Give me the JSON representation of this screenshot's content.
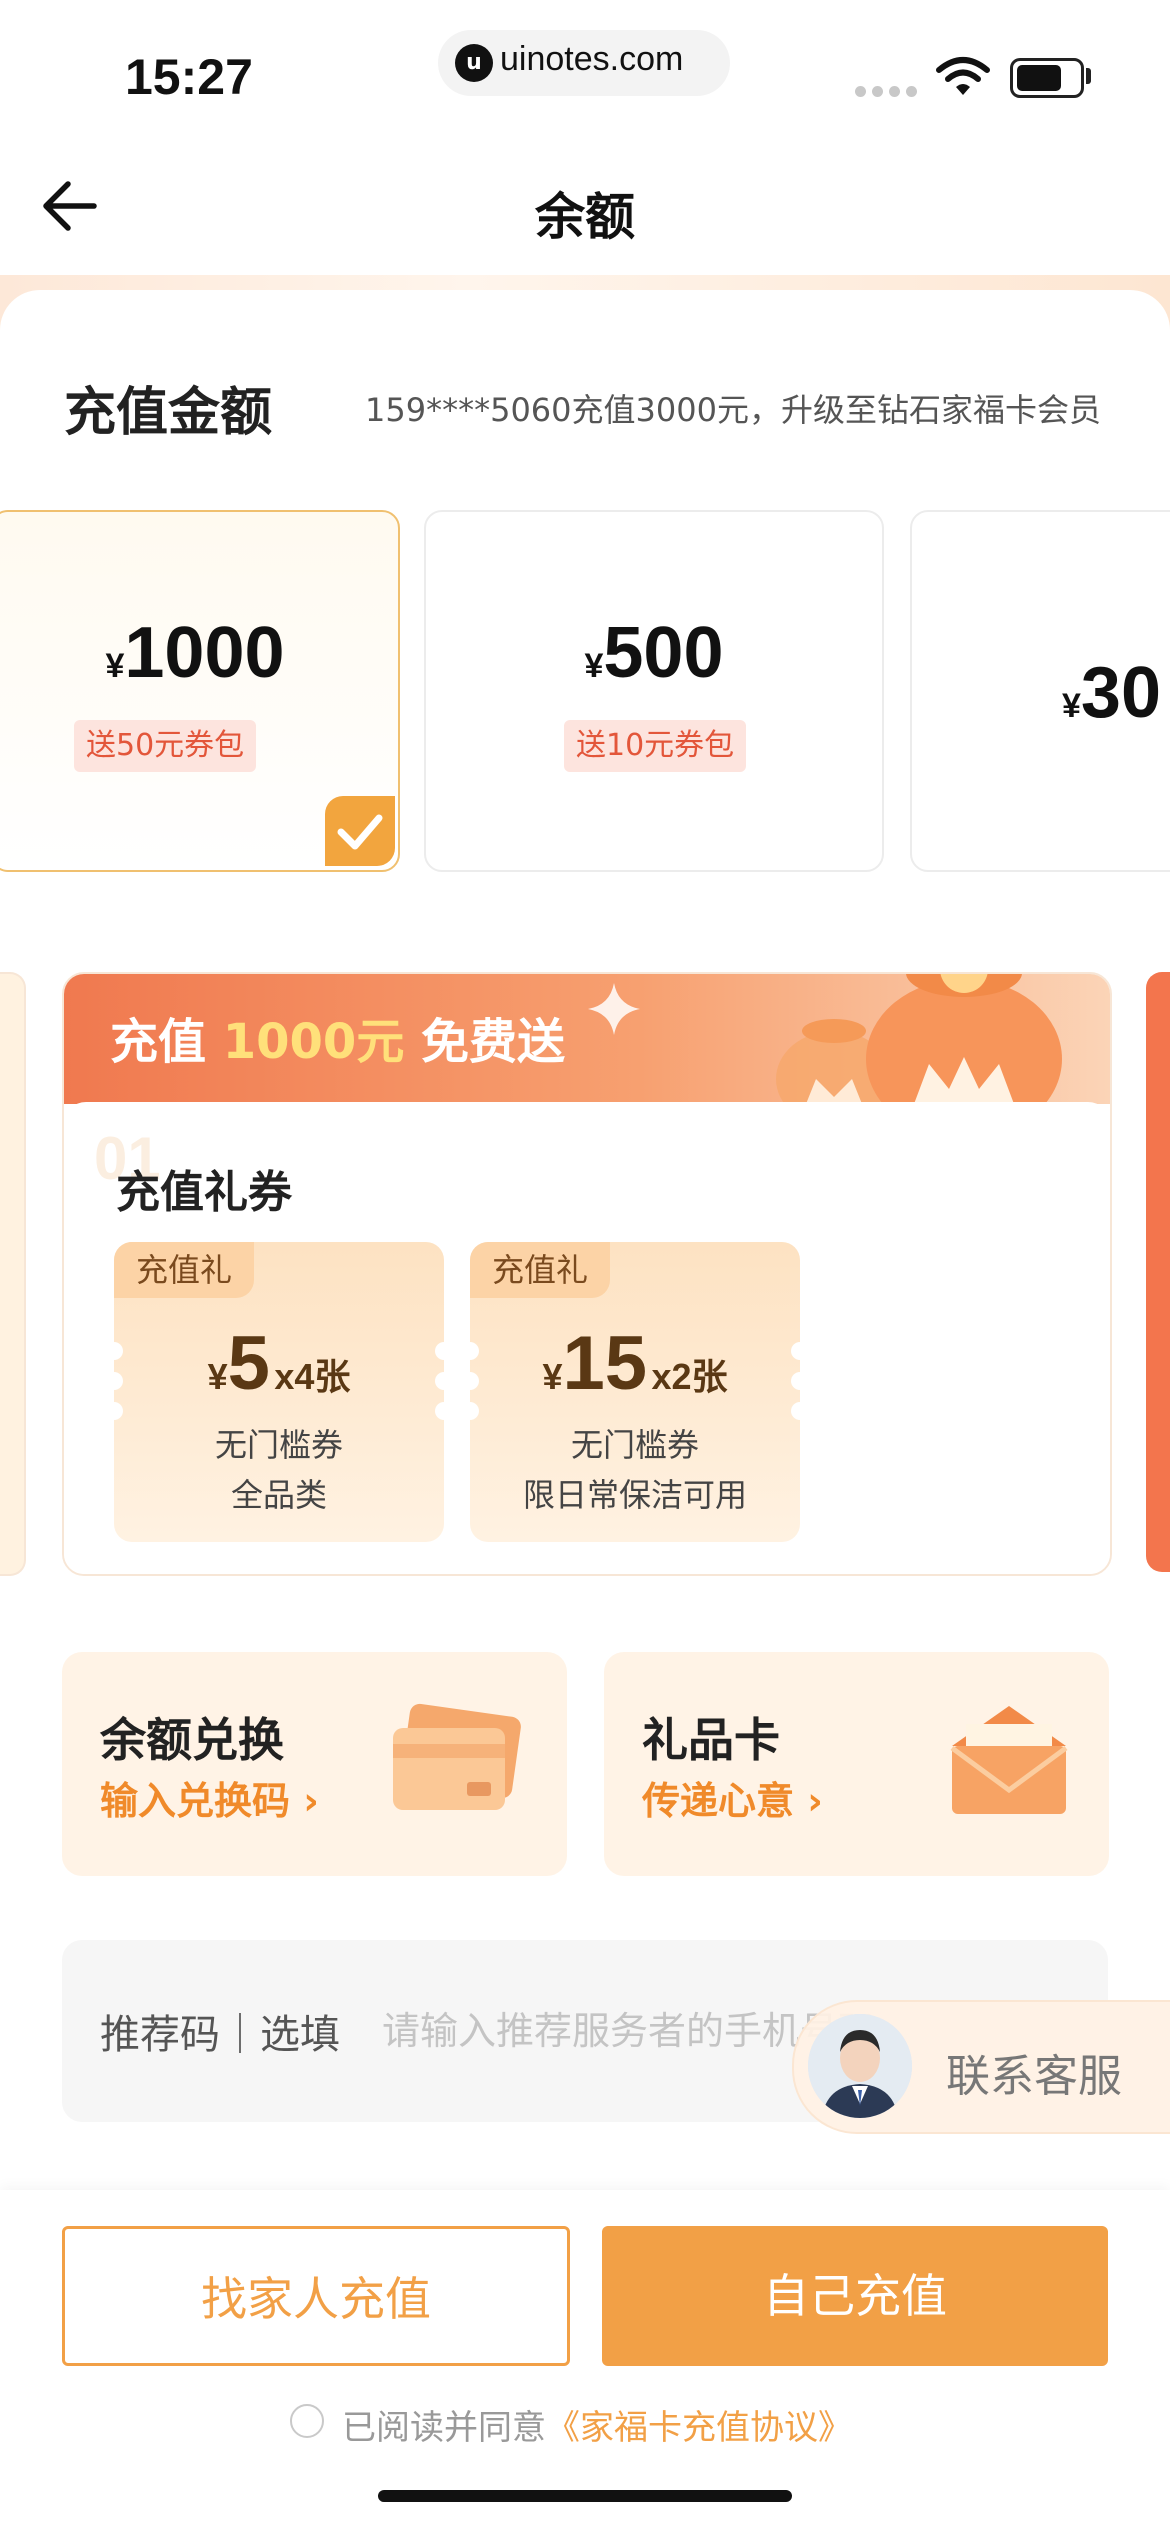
{
  "status_bar": {
    "time": "15:27",
    "url": "uinotes.com",
    "url_icon": "u"
  },
  "nav": {
    "title": "余额"
  },
  "recharge": {
    "title": "充值金额",
    "note": "159****5060充值3000元，升级至钻石家福卡会员",
    "tiers": [
      {
        "yen": "¥",
        "amount": "1000",
        "bonus": "送50元券包",
        "selected": true
      },
      {
        "yen": "¥",
        "amount": "500",
        "bonus": "送10元券包",
        "selected": false
      },
      {
        "yen": "¥",
        "amount": "30",
        "bonus": "",
        "selected": false
      }
    ]
  },
  "promo": {
    "head_prefix": "充值 ",
    "head_highlight": "1000元",
    "head_suffix": " 免费送",
    "bg_number": "01",
    "section_title": "充值礼券",
    "coupons": [
      {
        "tag": "充值礼",
        "yen": "¥",
        "value": "5",
        "qty": "x4张",
        "line1": "无门槛券",
        "line2": "全品类"
      },
      {
        "tag": "充值礼",
        "yen": "¥",
        "value": "15",
        "qty": "x2张",
        "line1": "无门槛券",
        "line2": "限日常保洁可用"
      }
    ]
  },
  "actions": [
    {
      "title": "余额兑换",
      "sub": "输入兑换码 ›"
    },
    {
      "title": "礼品卡",
      "sub": "传递心意 ›"
    }
  ],
  "referral": {
    "label": "推荐码｜选填",
    "placeholder": "请输入推荐服务者的手机号码"
  },
  "service": {
    "label": "联系客服"
  },
  "bottom": {
    "family_button": "找家人充值",
    "self_button": "自己充值",
    "agree_prefix": "已阅读并同意",
    "agree_link": "《家福卡充值协议》"
  },
  "colors": {
    "accent": "#f2a046",
    "bonus_text": "#e3563a",
    "sub_link": "#f08a2a"
  }
}
